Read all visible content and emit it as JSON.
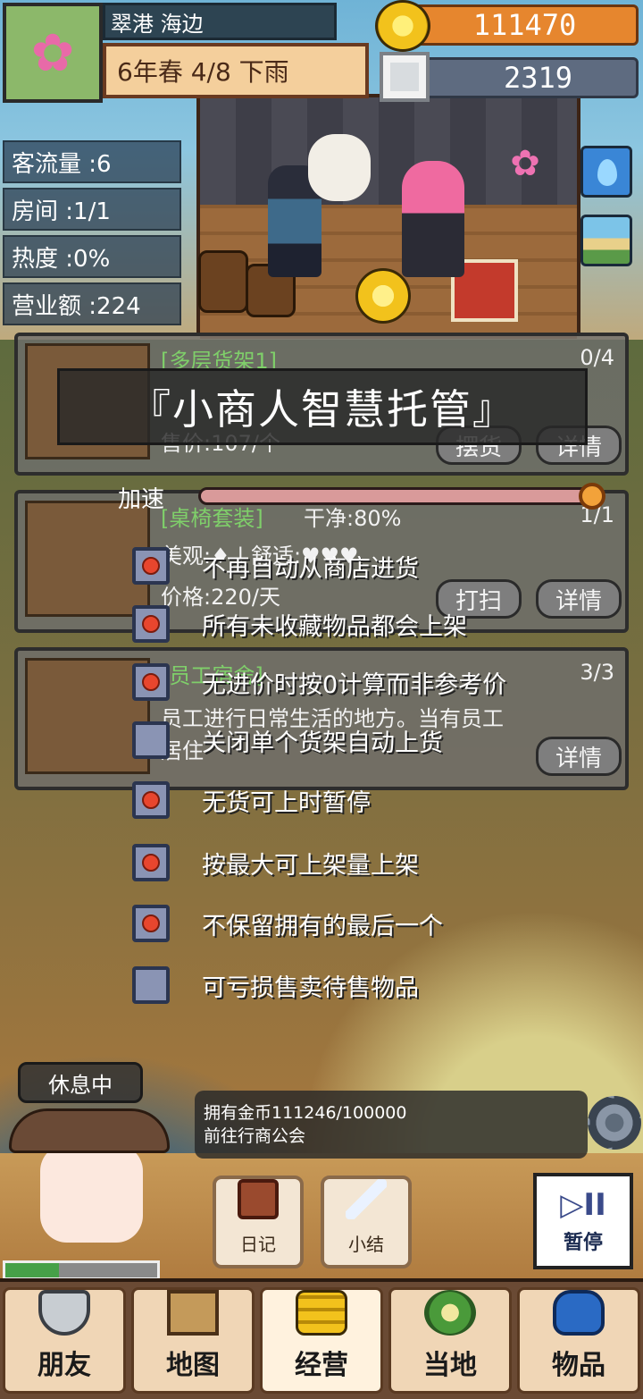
{
  "hud": {
    "location": "翠港 海边",
    "date": "6年春 4/8 下雨",
    "gold": "111470",
    "silver": "2319"
  },
  "stats": [
    {
      "label": "客流量 :6"
    },
    {
      "label": "房间 :1/1"
    },
    {
      "label": "热度 :0%"
    },
    {
      "label": "营业额 :224"
    }
  ],
  "cards": [
    {
      "name": "[多层货架1]",
      "count": "0/4",
      "lines": [
        "售价:107/个"
      ],
      "buttons": [
        "摆货",
        "详情"
      ]
    },
    {
      "name": "[桌椅套装]",
      "extra": "干净:80%",
      "count": "1/1",
      "lines": [
        "美观:♦ | 舒适:♥♥♥",
        "价格:220/天"
      ],
      "buttons": [
        "打扫",
        "详情"
      ]
    },
    {
      "name": "[员工宿舍]",
      "count": "3/3",
      "lines": [
        "员工进行日常生活的地方。当有员工",
        "居住"
      ],
      "buttons": [
        "详情"
      ]
    }
  ],
  "overlay": {
    "title": "『小商人智慧托管』",
    "speed_label": "加速",
    "speed_value": 0.98
  },
  "options": [
    {
      "label": "不再自动从商店进货",
      "checked": true
    },
    {
      "label": "所有未收藏物品都会上架",
      "checked": true
    },
    {
      "label": "无进价时按0计算而非参考价",
      "checked": true
    },
    {
      "label": "关闭单个货架自动上货",
      "checked": false
    },
    {
      "label": "无货可上时暂停",
      "checked": true
    },
    {
      "label": "按最大可上架量上架",
      "checked": true
    },
    {
      "label": "不保留拥有的最后一个",
      "checked": true
    },
    {
      "label": "可亏损售卖待售物品",
      "checked": false
    }
  ],
  "status": {
    "rest": "休息中",
    "task_line1": "拥有金币111246/100000",
    "task_line2": "前往行商公会",
    "hp_value": 0.35
  },
  "actions": {
    "diary": "日记",
    "summary": "小结",
    "pause": "暂停",
    "pause_symbol": "▷II"
  },
  "nav": [
    {
      "label": "朋友",
      "icon": "shield-icon"
    },
    {
      "label": "地图",
      "icon": "map-icon"
    },
    {
      "label": "经营",
      "icon": "coins-icon"
    },
    {
      "label": "当地",
      "icon": "local-icon"
    },
    {
      "label": "物品",
      "icon": "bag-icon"
    }
  ],
  "colors": {
    "gold": "#e6862e",
    "silver": "#5e6b80",
    "checkbox_on": "#e8462e",
    "card_title": "#7fcf6a"
  }
}
